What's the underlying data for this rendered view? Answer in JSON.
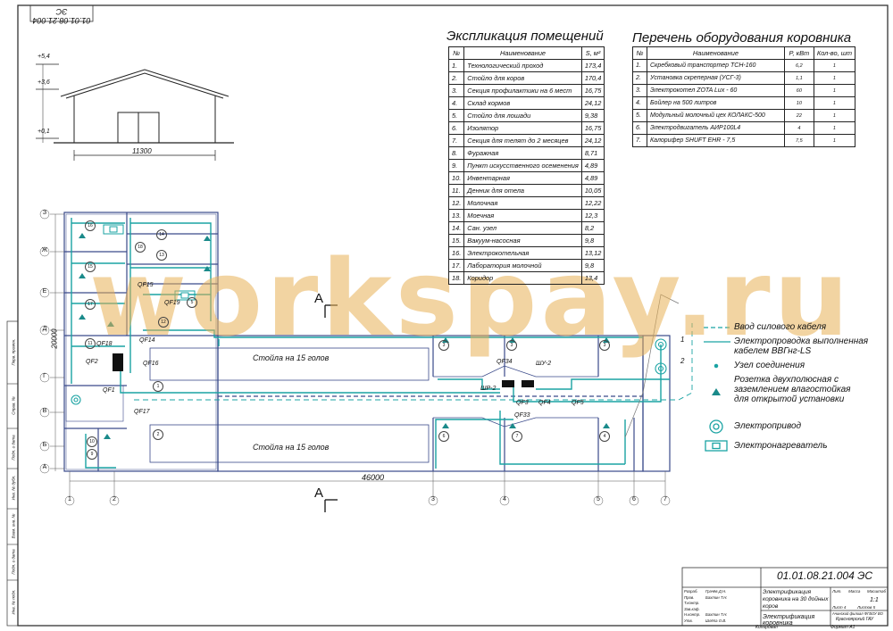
{
  "drawing_code": "01.01.08.21.004 ЭС",
  "elevation": {
    "levels": [
      "+5,4",
      "+3,6",
      "+0,1"
    ],
    "width": "11300"
  },
  "explication": {
    "title": "Экспликация помещений",
    "headers": [
      "№",
      "Наименование",
      "S, м²"
    ],
    "rows": [
      [
        "1.",
        "Технологический проход",
        "173,4"
      ],
      [
        "2.",
        "Стойло для коров",
        "170,4"
      ],
      [
        "3.",
        "Секция профилактики на 6 мест",
        "16,75"
      ],
      [
        "4.",
        "Склад кормов",
        "24,12"
      ],
      [
        "5.",
        "Стойло для лошади",
        "9,38"
      ],
      [
        "6.",
        "Изолятор",
        "16,75"
      ],
      [
        "7.",
        "Секция для телят до 2 месяцев",
        "24,12"
      ],
      [
        "8.",
        "Фуражная",
        "8,71"
      ],
      [
        "9.",
        "Пункт искусственного осеменения",
        "4,89"
      ],
      [
        "10.",
        "Инвентарная",
        "4,89"
      ],
      [
        "11.",
        "Денник для отела",
        "10,05"
      ],
      [
        "12.",
        "Молочная",
        "12,22"
      ],
      [
        "13.",
        "Моечная",
        "12,3"
      ],
      [
        "14.",
        "Сан. узел",
        "8,2"
      ],
      [
        "15.",
        "Вакуум-насосная",
        "9,8"
      ],
      [
        "16.",
        "Электрокотельная",
        "13,12"
      ],
      [
        "17.",
        "Лаборатория молочной",
        "9,8"
      ],
      [
        "18.",
        "Коридор",
        "13,4"
      ]
    ]
  },
  "equipment": {
    "title": "Перечень оборудования коровника",
    "headers": [
      "№",
      "Наименование",
      "P, кВт",
      "Кол-во, шт"
    ],
    "rows": [
      [
        "1.",
        "Скребковый транспортер ТСН-160",
        "6,2",
        "1"
      ],
      [
        "2.",
        "Установка скреперная (УСГ-3)",
        "1,1",
        "1"
      ],
      [
        "3.",
        "Электрокотел ZOTA Lux - 60",
        "60",
        "1"
      ],
      [
        "4.",
        "Бойлер на 500 литров",
        "10",
        "1"
      ],
      [
        "5.",
        "Модульный молочный цех КОЛАКС-500",
        "22",
        "1"
      ],
      [
        "6.",
        "Электродвигатель АИР100L4",
        "4",
        "1"
      ],
      [
        "7.",
        "Калорифер SHUFT EHR - 7,5",
        "7,5",
        "1"
      ]
    ]
  },
  "legend": [
    {
      "key": "cable-in",
      "label": "Ввод силового кабеля"
    },
    {
      "key": "wiring",
      "label": "Электропроводка выполненная кабелем ВВГнг-LS"
    },
    {
      "key": "junction",
      "label": "Узел соединения"
    },
    {
      "key": "socket",
      "label": "Розетка двухполюсная с заземлением влагостойкая для открытой установки"
    },
    {
      "key": "motor",
      "label": "Электропривод"
    },
    {
      "key": "heater",
      "label": "Электронагреватель"
    }
  ],
  "plan": {
    "row_axes": [
      "З",
      "Ж",
      "Е",
      "Д",
      "Г",
      "В",
      "Б",
      "А"
    ],
    "col_axes": [
      "1",
      "2",
      "3",
      "4",
      "5",
      "6",
      "7"
    ],
    "dim_length": "46000",
    "dim_height": "20000",
    "stall_label_top": "Стойла на 15 голов",
    "stall_label_bottom": "Стойла на 15 голов",
    "section_mark": "А",
    "breakers": [
      "QF1",
      "QF2",
      "QF3",
      "QF4",
      "QF5",
      "QF14",
      "QF15",
      "QF16",
      "QF17",
      "QF18",
      "QF19",
      "QF33",
      "QF34"
    ],
    "panels": [
      "ШР-2",
      "ШУ-2"
    ],
    "feed_numbers": [
      "1",
      "2"
    ]
  },
  "stamp": {
    "code": "01.01.08.21.004 ЭС",
    "project": "Электрификация коровника на 30 дойных коров",
    "sheet_title": "Электрификация коровника",
    "scale": "1:1",
    "org": "Красноярский ГАУ",
    "format": "Формат А1",
    "copied": "Копировал",
    "col_heads": [
      "Лит.",
      "Масса",
      "Масштаб"
    ],
    "sheet_label": "Лист 4",
    "sheets_label": "Листов 5",
    "roles": [
      "Разраб.",
      "Пров.",
      "Т.контр.",
      "Зав.каф.",
      "Н.контр.",
      "Утв."
    ],
    "names": [
      "Грачёв Д.Н.",
      "Бахтин Т.Н.",
      "",
      "",
      "Бахтин Т.Н.",
      "Шлёпа О.В."
    ],
    "faculty": "Ачинский филиал ФГБОУ ВО"
  },
  "side_stamp": [
    "Перв. примен.",
    "Справ. №",
    "Подп. и дата",
    "Инв. № дубл.",
    "Взам. инв. №",
    "Подп. и дата",
    "Инв. № подл."
  ],
  "watermark": "workspay.ru",
  "colors": {
    "wiring": "#1aa3a3",
    "walls": "#3a4a8a",
    "watermark": "#e8b056"
  }
}
